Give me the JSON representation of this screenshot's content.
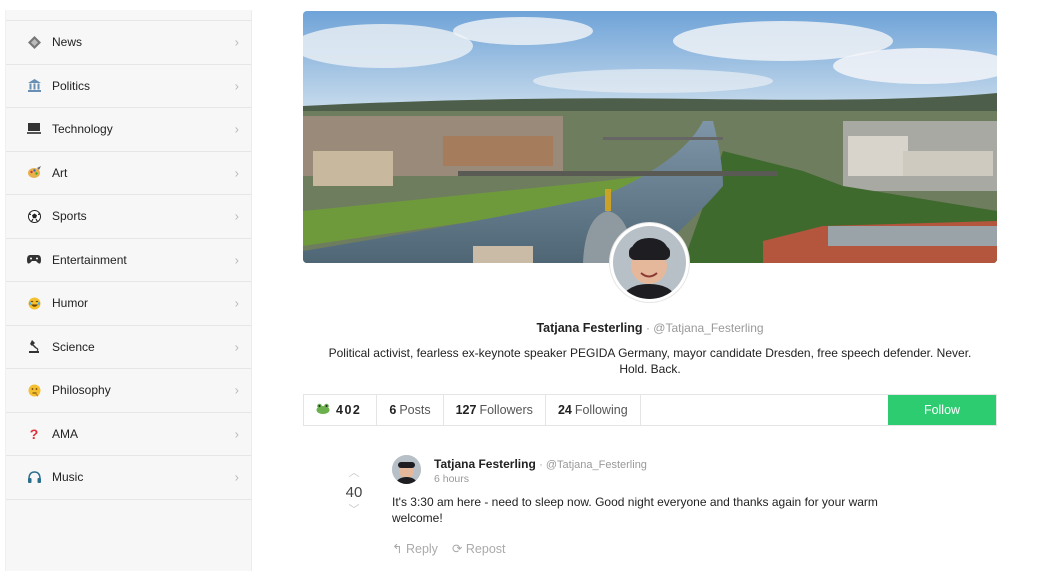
{
  "sidebar": {
    "items": [
      {
        "label": "News",
        "icon": "news-icon"
      },
      {
        "label": "Politics",
        "icon": "politics-icon"
      },
      {
        "label": "Technology",
        "icon": "technology-icon"
      },
      {
        "label": "Art",
        "icon": "art-icon"
      },
      {
        "label": "Sports",
        "icon": "sports-icon"
      },
      {
        "label": "Entertainment",
        "icon": "entertainment-icon"
      },
      {
        "label": "Humor",
        "icon": "humor-icon"
      },
      {
        "label": "Science",
        "icon": "science-icon"
      },
      {
        "label": "Philosophy",
        "icon": "philosophy-icon"
      },
      {
        "label": "AMA",
        "icon": "ama-icon"
      },
      {
        "label": "Music",
        "icon": "music-icon"
      }
    ]
  },
  "profile": {
    "name": "Tatjana Festerling",
    "handle": "· @Tatjana_Festerling",
    "bio": "Political activist, fearless ex-keynote speaker PEGIDA Germany, mayor candidate Dresden, free speech defender. Never. Hold. Back."
  },
  "stats": {
    "points": "402",
    "posts_count": "6",
    "posts_label": "Posts",
    "followers_count": "127",
    "followers_label": "Followers",
    "following_count": "24",
    "following_label": "Following",
    "follow_button": "Follow"
  },
  "post": {
    "votes": "40",
    "author": "Tatjana Festerling",
    "handle": "· @Tatjana_Festerling",
    "time": "6 hours",
    "text": "It's 3:30 am here - need to sleep now. Good night everyone and thanks again for your warm welcome!",
    "reply_label": "Reply",
    "repost_label": "Repost"
  },
  "colors": {
    "follow_green": "#2ecc71",
    "sidebar_bg": "#f7f7f7"
  }
}
